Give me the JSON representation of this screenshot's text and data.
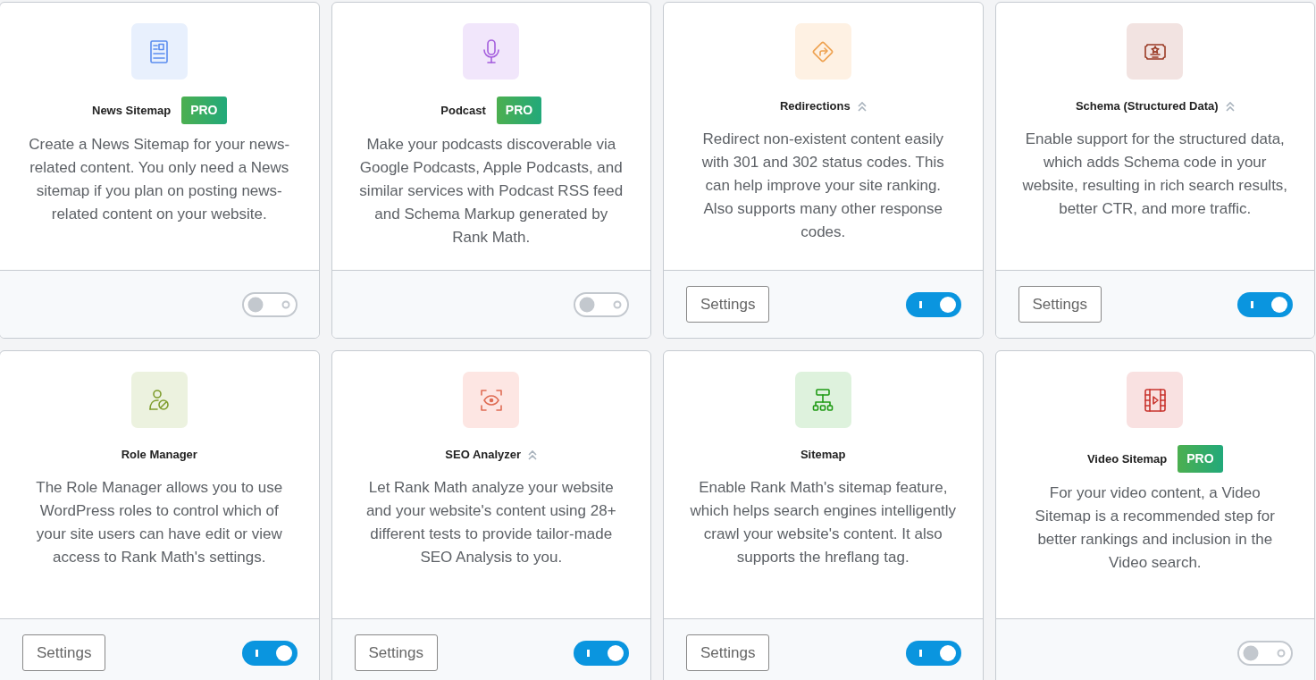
{
  "modules": [
    {
      "kind": "news",
      "title": "News Sitemap",
      "badge": "PRO",
      "description": "Create a News Sitemap for your news-related content. You only need a News sitemap if you plan on posting news-related content on your website.",
      "enabled": false
    },
    {
      "kind": "podcast",
      "title": "Podcast",
      "badge": "PRO",
      "description": "Make your podcasts discoverable via Google Podcasts, Apple Podcasts, and similar services with Podcast RSS feed and Schema Markup generated by Rank Math.",
      "enabled": false
    },
    {
      "kind": "redirect",
      "title": "Redirections",
      "advanced": true,
      "description": "Redirect non-existent content easily with 301 and 302 status codes. This can help improve your site ranking. Also supports many other response codes.",
      "settings": "Settings",
      "enabled": true
    },
    {
      "kind": "schema",
      "title": "Schema (Structured Data)",
      "advanced": true,
      "description": "Enable support for the structured data, which adds Schema code in your website, resulting in rich search results, better CTR, and more traffic.",
      "settings": "Settings",
      "enabled": true
    },
    {
      "kind": "role",
      "title": "Role Manager",
      "description": "The Role Manager allows you to use WordPress roles to control which of your site users can have edit or view access to Rank Math's settings.",
      "settings": "Settings",
      "enabled": true
    },
    {
      "kind": "analyzer",
      "title": "SEO Analyzer",
      "advanced": true,
      "description": "Let Rank Math analyze your website and your website's content using 28+ different tests to provide tailor-made SEO Analysis to you.",
      "settings": "Settings",
      "enabled": true
    },
    {
      "kind": "sitemap",
      "title": "Sitemap",
      "description": "Enable Rank Math's sitemap feature, which helps search engines intelligently crawl your website's content. It also supports the hreflang tag.",
      "settings": "Settings",
      "enabled": true
    },
    {
      "kind": "video",
      "title": "Video Sitemap",
      "badge": "PRO",
      "description": "For your video content, a Video Sitemap is a recommended step for better rankings and inclusion in the Video search.",
      "enabled": false
    }
  ]
}
